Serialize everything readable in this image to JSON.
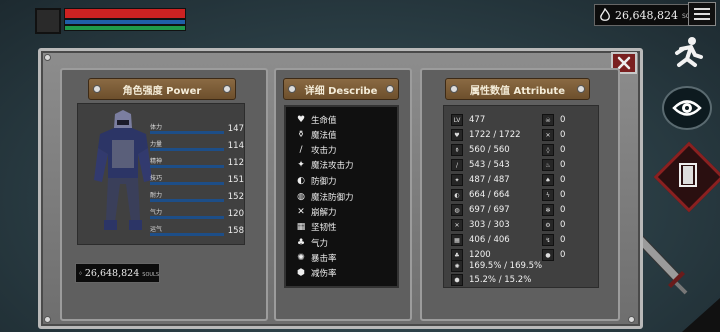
{
  "hud": {
    "hp_fill": 1.0,
    "mp_fill": 1.0,
    "xp_fill": 1.0
  },
  "souls": {
    "amount": "26,648,824",
    "unit": "SOULS"
  },
  "power_panel": {
    "title": "角色强度 Power",
    "stats": [
      {
        "label": "体力",
        "value": "147"
      },
      {
        "label": "力量",
        "value": "114"
      },
      {
        "label": "精神",
        "value": "112"
      },
      {
        "label": "技巧",
        "value": "151"
      },
      {
        "label": "耐力",
        "value": "152"
      },
      {
        "label": "气力",
        "value": "120"
      },
      {
        "label": "运气",
        "value": "158"
      }
    ]
  },
  "describe_panel": {
    "title": "详细 Describe",
    "items": [
      {
        "label": "生命值",
        "icon": "heart-icon"
      },
      {
        "label": "魔法值",
        "icon": "potion-icon"
      },
      {
        "label": "攻击力",
        "icon": "sword-icon"
      },
      {
        "label": "魔法攻击力",
        "icon": "magic-attack-icon"
      },
      {
        "label": "防御力",
        "icon": "shield-icon"
      },
      {
        "label": "魔法防御力",
        "icon": "magic-defense-icon"
      },
      {
        "label": "崩解力",
        "icon": "crossed-swords-icon"
      },
      {
        "label": "坚韧性",
        "icon": "armor-icon"
      },
      {
        "label": "气力",
        "icon": "lungs-icon"
      },
      {
        "label": "暴击率",
        "icon": "burst-icon"
      },
      {
        "label": "减伤率",
        "icon": "guard-icon"
      }
    ]
  },
  "attr_panel": {
    "title": "属性数值 Attribute",
    "left": [
      {
        "icon": "level-icon",
        "value": "477"
      },
      {
        "icon": "heart-icon",
        "value": "1722 / 1722"
      },
      {
        "icon": "potion-icon",
        "value": "560 / 560"
      },
      {
        "icon": "sword-icon",
        "value": "543 / 543"
      },
      {
        "icon": "magic-attack-icon",
        "value": "487 / 487"
      },
      {
        "icon": "shield-icon",
        "value": "664 / 664"
      },
      {
        "icon": "magic-defense-icon",
        "value": "697 / 697"
      },
      {
        "icon": "crossed-swords-icon",
        "value": "303 / 303"
      },
      {
        "icon": "armor-icon",
        "value": "406 / 406"
      },
      {
        "icon": "lungs-icon",
        "value": "1200"
      }
    ],
    "right": [
      {
        "icon": "skull-icon",
        "value": "0"
      },
      {
        "icon": "bones-icon",
        "value": "0"
      },
      {
        "icon": "drop-icon",
        "value": "0"
      },
      {
        "icon": "fire-icon",
        "value": "0"
      },
      {
        "icon": "flame-icon",
        "value": "0"
      },
      {
        "icon": "lightning-icon",
        "value": "0"
      },
      {
        "icon": "snowflake-icon",
        "value": "0"
      },
      {
        "icon": "gear-icon",
        "value": "0"
      },
      {
        "icon": "bolt-icon",
        "value": "0"
      },
      {
        "icon": "orb-icon",
        "value": "0"
      }
    ],
    "crit": {
      "icon": "burst-icon",
      "value": "169.5% / 169.5%"
    },
    "reduction": {
      "icon": "guard-icon",
      "value": "15.2% / 15.2%"
    }
  }
}
